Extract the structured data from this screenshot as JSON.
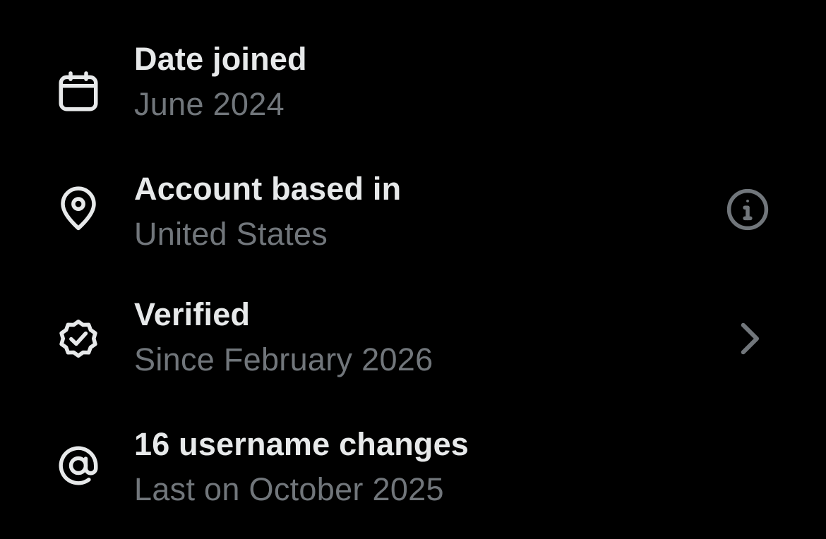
{
  "colors": {
    "background": "#000000",
    "title": "#e7e9ea",
    "subtitle": "#71767b",
    "icon": "#e7e9ea",
    "trailing_icon": "#71767b"
  },
  "rows": [
    {
      "icon": "calendar-icon",
      "title": "Date joined",
      "subtitle": "June 2024"
    },
    {
      "icon": "location-pin-icon",
      "title": "Account based in",
      "subtitle": "United States",
      "trailing_icon": "info-icon"
    },
    {
      "icon": "verified-badge-icon",
      "title": "Verified",
      "subtitle": "Since February 2026",
      "trailing_icon": "chevron-right-icon"
    },
    {
      "icon": "at-sign-icon",
      "title": "16 username changes",
      "subtitle": "Last on October 2025"
    }
  ]
}
